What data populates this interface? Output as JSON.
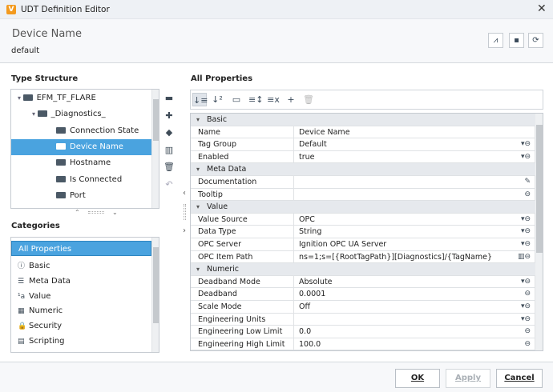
{
  "window": {
    "title": "UDT Definition Editor",
    "app_icon": "V",
    "close": "✕"
  },
  "header": {
    "title": "Device Name",
    "subtitle": "default",
    "buttons": [
      {
        "icon": "diagnostics-icon",
        "glyph": "⩘"
      },
      {
        "icon": "note-icon",
        "glyph": "▪"
      },
      {
        "icon": "refresh-icon",
        "glyph": "⟳"
      }
    ]
  },
  "type_structure": {
    "label": "Type Structure",
    "items": [
      {
        "label": "EFM_TF_FLARE",
        "level": 0,
        "expanded": true,
        "selected": false
      },
      {
        "label": "_Diagnostics_",
        "level": 1,
        "expanded": true,
        "selected": false
      },
      {
        "label": "Connection State",
        "level": 2,
        "selected": false
      },
      {
        "label": "Device Name",
        "level": 2,
        "selected": true
      },
      {
        "label": "Hostname",
        "level": 2,
        "selected": false
      },
      {
        "label": "Is Connected",
        "level": 2,
        "selected": false
      },
      {
        "label": "Port",
        "level": 2,
        "selected": false
      }
    ],
    "side_tools": [
      "folder-icon",
      "add-tag-icon",
      "tag-icon",
      "parameters-icon",
      "delete-icon",
      "undo-icon"
    ]
  },
  "categories": {
    "label": "Categories",
    "items": [
      {
        "label": "All Properties",
        "icon": "",
        "selected": true
      },
      {
        "label": "Basic",
        "icon": "ⓘ"
      },
      {
        "label": "Meta Data",
        "icon": "☰"
      },
      {
        "label": "Value",
        "icon": "¹a"
      },
      {
        "label": "Numeric",
        "icon": "▦"
      },
      {
        "label": "Security",
        "icon": "🔒"
      },
      {
        "label": "Scripting",
        "icon": "▤"
      }
    ]
  },
  "properties": {
    "label": "All Properties",
    "toolbar": [
      {
        "name": "sort-category-icon",
        "glyph": "↓≡"
      },
      {
        "name": "sort-alpha-icon",
        "glyph": "↓²"
      },
      {
        "name": "toggle-panel-icon",
        "glyph": "▭"
      },
      {
        "name": "expand-all-icon",
        "glyph": "≡↕"
      },
      {
        "name": "collapse-all-icon",
        "glyph": "≡x"
      },
      {
        "name": "add-icon",
        "glyph": "+"
      },
      {
        "name": "delete-icon",
        "glyph": "🗑"
      }
    ],
    "rows": [
      {
        "category": "Basic"
      },
      {
        "name": "Name",
        "value": "Device Name",
        "actions": ""
      },
      {
        "name": "Tag Group",
        "value": "Default",
        "actions": "▾⊖"
      },
      {
        "name": "Enabled",
        "value": "true",
        "actions": "▾⊖"
      },
      {
        "category": "Meta Data"
      },
      {
        "name": "Documentation",
        "value": "",
        "actions": "✎"
      },
      {
        "name": "Tooltip",
        "value": "",
        "actions": "⊖"
      },
      {
        "category": "Value"
      },
      {
        "name": "Value Source",
        "value": "OPC",
        "actions": "▾⊖"
      },
      {
        "name": "Data Type",
        "value": "String",
        "actions": "▾⊖"
      },
      {
        "name": "OPC Server",
        "value": "Ignition OPC UA Server",
        "actions": "▾⊖"
      },
      {
        "name": "OPC Item Path",
        "value": "ns=1;s=[{RootTagPath}][Diagnostics]/{TagName}",
        "actions": "▥⊖"
      },
      {
        "category": "Numeric"
      },
      {
        "name": "Deadband Mode",
        "value": "Absolute",
        "actions": "▾⊖"
      },
      {
        "name": "Deadband",
        "value": "0.0001",
        "actions": "⊖"
      },
      {
        "name": "Scale Mode",
        "value": "Off",
        "actions": "▾⊖"
      },
      {
        "name": "Engineering Units",
        "value": "",
        "actions": "▾⊖"
      },
      {
        "name": "Engineering Low Limit",
        "value": "0.0",
        "actions": "⊖"
      },
      {
        "name": "Engineering High Limit",
        "value": "100.0",
        "actions": "⊖"
      }
    ]
  },
  "footer": {
    "ok": "OK",
    "apply": "Apply",
    "cancel": "Cancel"
  }
}
